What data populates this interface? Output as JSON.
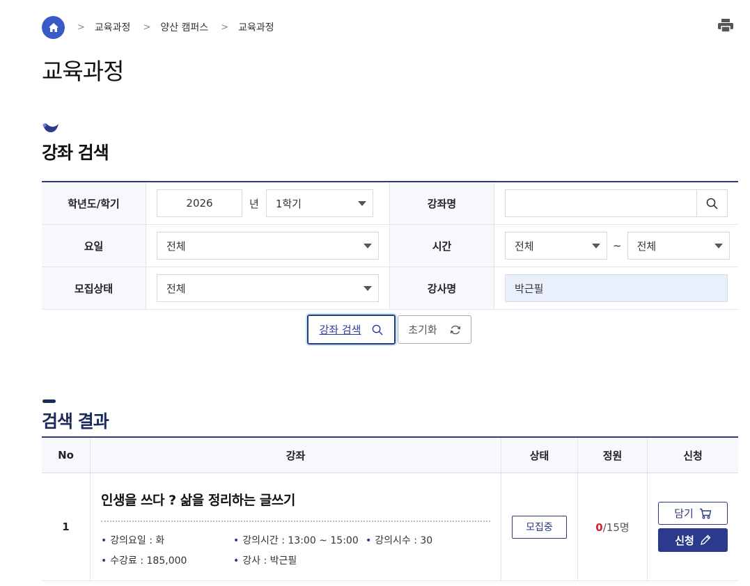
{
  "breadcrumb": {
    "home_icon": "home-icon",
    "items": [
      "교육과정",
      "양산 캠퍼스",
      "교육과정"
    ]
  },
  "page": {
    "title": "교육과정",
    "print_icon": "printer-icon"
  },
  "search": {
    "heading": "강좌 검색",
    "year_label": "학년도/학기",
    "year_value": "2026",
    "year_unit": "년",
    "semester_value": "1학기",
    "course_name_label": "강좌명",
    "course_name_value": "",
    "day_label": "요일",
    "day_value": "전체",
    "time_label": "시간",
    "time_from": "전체",
    "time_sep": "~",
    "time_to": "전체",
    "status_label": "모집상태",
    "status_value": "전체",
    "instructor_label": "강사명",
    "instructor_value": "박근필",
    "search_button": "강좌 검색",
    "reset_button": "초기화"
  },
  "results": {
    "heading": "검색 결과",
    "columns": [
      "No",
      "강좌",
      "상태",
      "정원",
      "신청"
    ],
    "rows": [
      {
        "no": "1",
        "title": "인생을 쓰다 ? 삶을 정리하는 글쓰기",
        "day": "강의요일 : 화",
        "time": "강의시간 : 13:00 ~ 15:00",
        "hours": "강의시수 : 30",
        "fee": "수강료 : 185,000",
        "instructor": "강사 : 박근필",
        "status": "모집중",
        "enrolled": "0",
        "capacity": "/15명",
        "cart_button": "담기",
        "apply_button": "신청"
      }
    ]
  },
  "colors": {
    "primary": "#2b3a7a",
    "accent_red": "#d3232a",
    "home_blue": "#3a5bc7"
  }
}
